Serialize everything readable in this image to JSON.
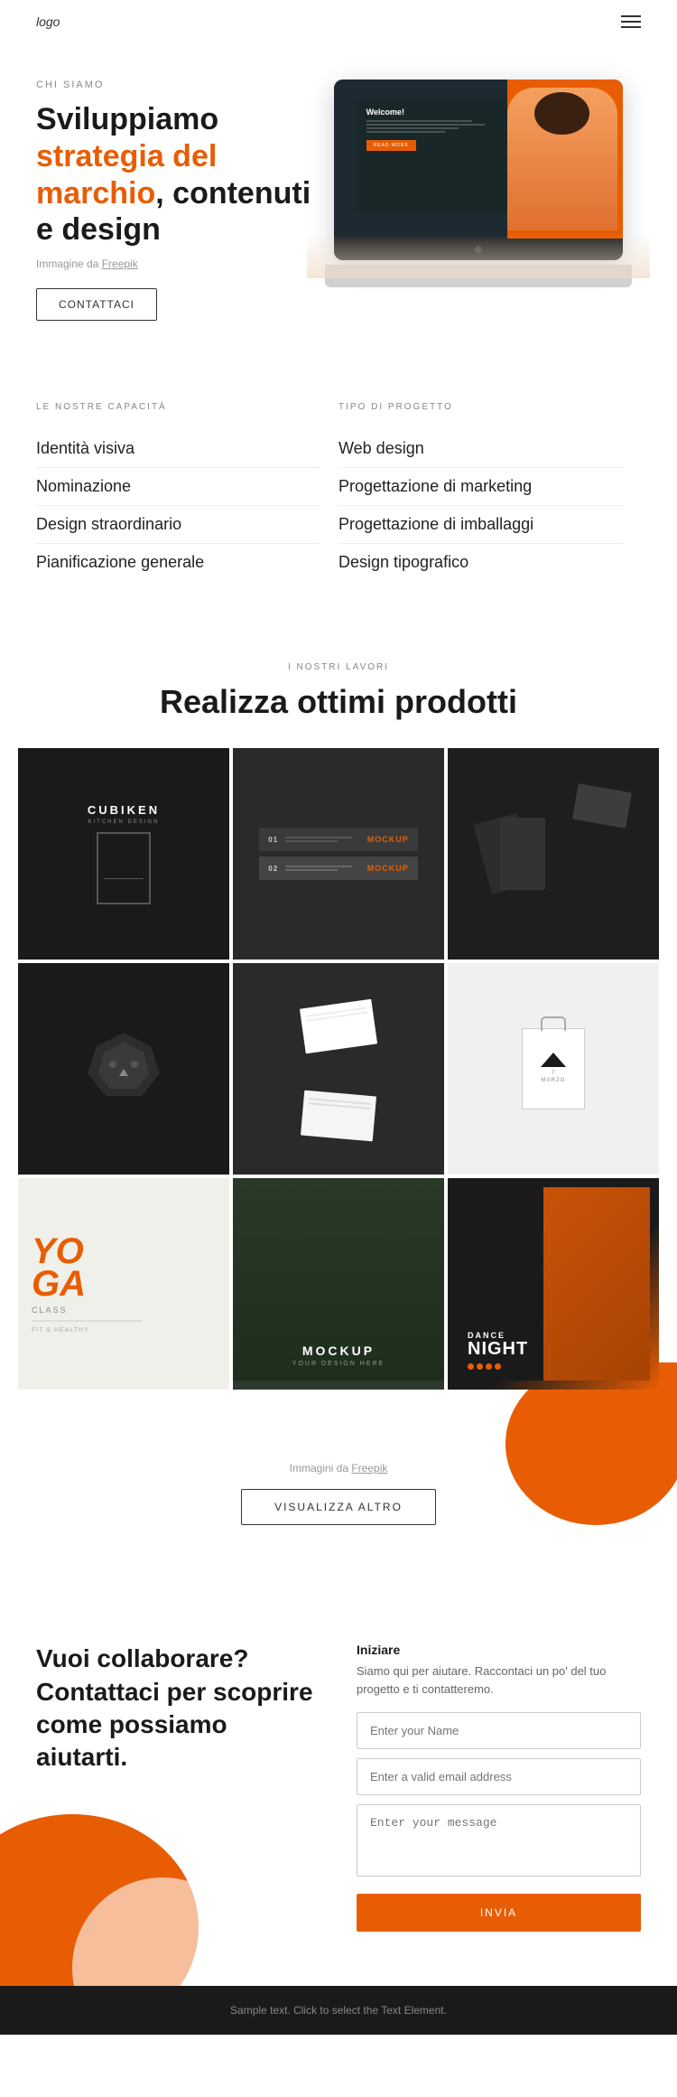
{
  "nav": {
    "logo": "logo",
    "menu_icon": "hamburger-icon"
  },
  "hero": {
    "tag": "CHI SIAMO",
    "title_line1": "Sviluppiamo ",
    "title_orange": "strategia del marchio",
    "title_line2": ", contenuti e design",
    "image_credit_prefix": "Immagine da ",
    "image_credit_link": "Freepik",
    "cta_button": "CONTATTACI",
    "screen_welcome": "Welcome!"
  },
  "capabilities": {
    "col1_header": "LE NOSTRE CAPACITÀ",
    "col2_header": "TIPO DI PROGETTO",
    "col1_items": [
      "Identità visiva",
      "Nominazione",
      "Design straordinario",
      "Pianificazione generale"
    ],
    "col2_items": [
      "Web design",
      "Progettazione di marketing",
      "Progettazione di imballaggi",
      "Design tipografico"
    ]
  },
  "portfolio": {
    "tag": "I NOSTRI LAVORI",
    "title": "Realizza ottimi prodotti",
    "credit_prefix": "Immagini da ",
    "credit_link": "Freepik",
    "view_more_button": "VISUALIZZA ALTRO",
    "items": [
      {
        "id": "cubiken",
        "type": "cubiken"
      },
      {
        "id": "mockup1",
        "type": "mockup1"
      },
      {
        "id": "dark-cards",
        "type": "dark-cards"
      },
      {
        "id": "lion",
        "type": "lion"
      },
      {
        "id": "business-cards",
        "type": "business-cards"
      },
      {
        "id": "shopping-bag",
        "type": "shopping-bag"
      },
      {
        "id": "yoga",
        "type": "yoga"
      },
      {
        "id": "mockup2",
        "type": "mockup2"
      },
      {
        "id": "dance",
        "type": "dance"
      }
    ]
  },
  "cta": {
    "title": "Vuoi collaborare? Contattaci per scoprire come possiamo aiutarti.",
    "form_title": "Iniziare",
    "form_desc": "Siamo qui per aiutare. Raccontaci un po' del tuo progetto e ti contatteremo.",
    "name_placeholder": "Enter your Name",
    "email_placeholder": "Enter a valid email address",
    "message_placeholder": "Enter your message",
    "submit_button": "INVIA"
  },
  "footer": {
    "text": "Sample text. Click to select the Text Element."
  },
  "colors": {
    "orange": "#e85d04",
    "dark": "#1a1a1a",
    "gray": "#888888"
  }
}
